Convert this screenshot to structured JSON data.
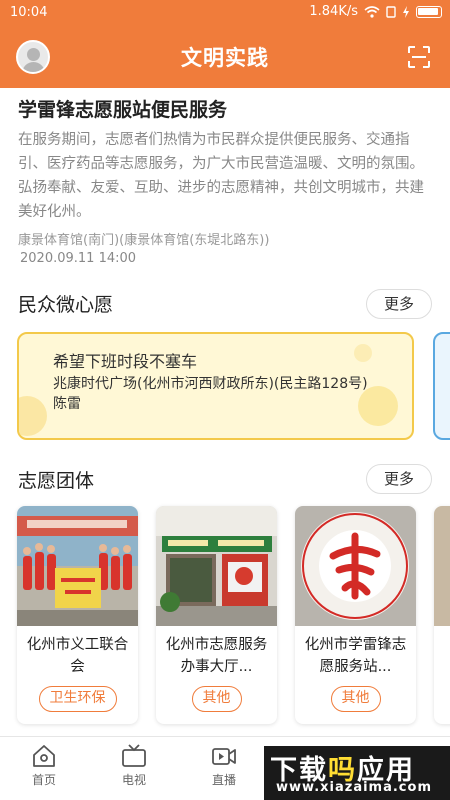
{
  "status_bar": {
    "time": "10:04",
    "network_speed": "1.84K/s",
    "icons": [
      "wifi-icon",
      "sim-icon",
      "charging-icon",
      "battery-icon"
    ]
  },
  "header": {
    "title": "文明实践",
    "avatar_icon": "avatar-icon",
    "scan_icon": "scan-icon"
  },
  "news": {
    "title": "学雷锋志愿服站便民服务",
    "body": "在服务期间，志愿者们热情为市民群众提供便民服务、交通指引、医疗药品等志愿服务，为广大市民营造温暖、文明的氛围。弘扬奉献、友爱、互助、进步的志愿精神，共创文明城市，共建美好化州。",
    "location": "康景体育馆(南门)(康景体育馆(东堤北路东))",
    "date": "2020.09.11 14:00"
  },
  "wishes_section": {
    "title": "民众微心愿",
    "more_label": "更多",
    "items": [
      {
        "title": "希望下班时段不塞车",
        "info": "兆康时代广场(化州市河西财政所东)(民主路128号) 陈雷",
        "border_color": "#f3c94a"
      }
    ]
  },
  "groups_section": {
    "title": "志愿团体",
    "more_label": "更多",
    "items": [
      {
        "name": "化州市义工联合会",
        "tag": "卫生环保",
        "image": "group-photo"
      },
      {
        "name": "化州市志愿服务办事大厅...",
        "tag": "其他",
        "image": "service-hall-photo"
      },
      {
        "name": "化州市学雷锋志愿服务站...",
        "tag": "其他",
        "image": "federation-logo"
      }
    ]
  },
  "bottom_nav": {
    "items": [
      {
        "label": "首页",
        "icon": "home-icon"
      },
      {
        "label": "电视",
        "icon": "tv-icon"
      },
      {
        "label": "直播",
        "icon": "live-icon"
      }
    ]
  },
  "watermark": {
    "line1_a": "下载",
    "line1_b": "吗",
    "line1_c": "应用",
    "line2": "www.xiazaima.com"
  },
  "colors": {
    "accent": "#f07c3b",
    "wish_bg": "#fff8d6",
    "wish_border": "#f3c94a",
    "peek_border": "#5aa8e0"
  }
}
